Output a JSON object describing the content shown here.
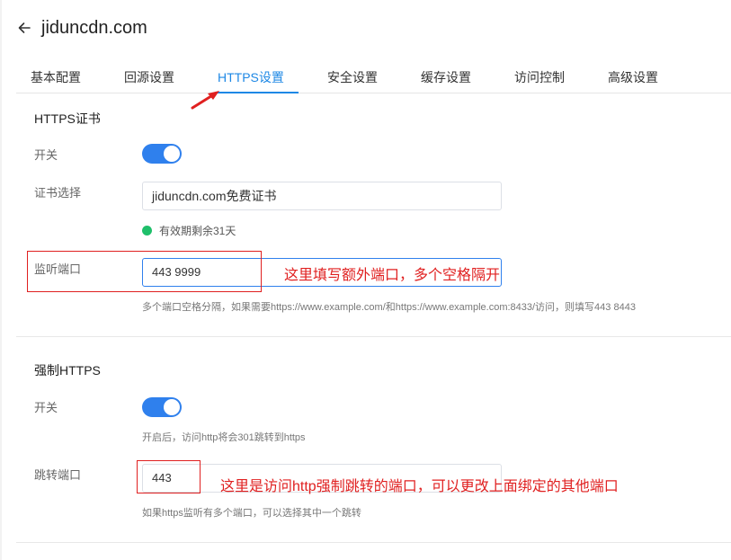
{
  "header": {
    "title": "jiduncdn.com",
    "back_icon": "arrow-left-icon"
  },
  "tabs": [
    {
      "label": "基本配置",
      "active": false
    },
    {
      "label": "回源设置",
      "active": false
    },
    {
      "label": "HTTPS设置",
      "active": true
    },
    {
      "label": "安全设置",
      "active": false
    },
    {
      "label": "缓存设置",
      "active": false
    },
    {
      "label": "访问控制",
      "active": false
    },
    {
      "label": "高级设置",
      "active": false
    }
  ],
  "https_cert": {
    "section_title": "HTTPS证书",
    "switch_label": "开关",
    "switch_on": true,
    "cert_label": "证书选择",
    "cert_value": "jiduncdn.com免费证书",
    "status_text": "有效期剩余31天",
    "port_label": "监听端口",
    "port_value": "443 9999",
    "port_hint": "多个端口空格分隔，如果需要https://www.example.com/和https://www.example.com:8433/访问，则填写443 8443"
  },
  "force_https": {
    "section_title": "强制HTTPS",
    "switch_label": "开关",
    "switch_on": true,
    "switch_hint": "开启后，访问http将会301跳转到https",
    "redirect_label": "跳转端口",
    "redirect_value": "443",
    "redirect_hint": "如果https监听有多个端口，可以选择其中一个跳转"
  },
  "annotations": {
    "port_note": "这里填写额外端口，多个空格隔开",
    "redirect_note": "这里是访问http强制跳转的端口，可以更改上面绑定的其他端口"
  },
  "colors": {
    "accent": "#1e88e5",
    "switch": "#2f80ed",
    "status_ok": "#1fbf6a",
    "annotation": "#e02020"
  }
}
